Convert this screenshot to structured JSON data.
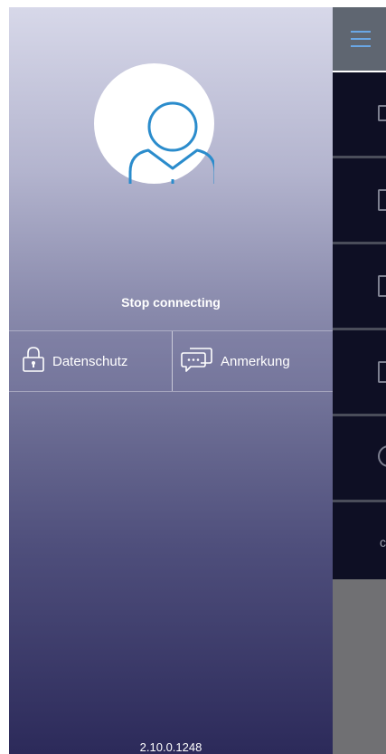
{
  "drawer": {
    "status_text": "Stop connecting",
    "actions": [
      {
        "label": "Datenschutz",
        "icon": "lock-icon"
      },
      {
        "label": "Anmerkung",
        "icon": "chat-bubbles-icon"
      }
    ],
    "version": "2.10.0.1248"
  },
  "background_app": {
    "menu_icon": "hamburger-menu-icon"
  },
  "colors": {
    "accent_blue": "#2b8ccc",
    "drawer_top": "#d7d8e9",
    "drawer_bottom": "#2c2a5a",
    "menu_dark": "#0e0f24"
  }
}
